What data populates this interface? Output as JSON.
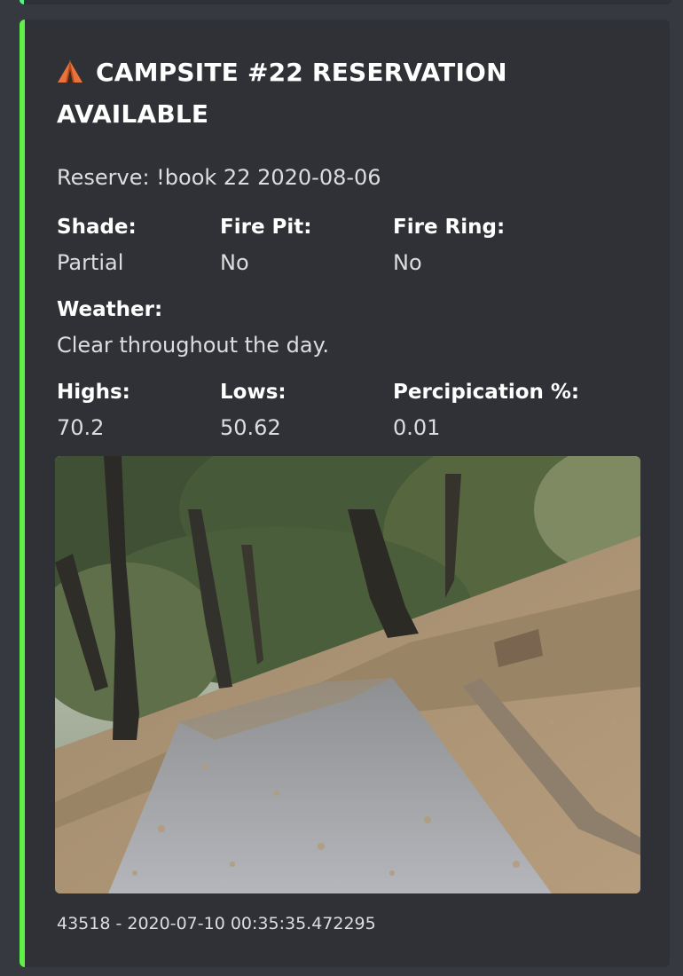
{
  "colors": {
    "accent_bar": "#5ff047",
    "embed_background": "#2f3136",
    "page_background": "#36393f"
  },
  "embed": {
    "title_icon": "tent-icon",
    "title": "CAMPSITE #22 RESERVATION AVAILABLE",
    "description": "Reserve: !book 22 2020-08-06",
    "fields": {
      "shade": {
        "name": "Shade:",
        "value": "Partial"
      },
      "fire_pit": {
        "name": "Fire Pit:",
        "value": "No"
      },
      "fire_ring": {
        "name": "Fire Ring:",
        "value": "No"
      },
      "weather": {
        "name": "Weather:",
        "value": "Clear throughout the day."
      },
      "highs": {
        "name": "Highs:",
        "value": "70.2"
      },
      "lows": {
        "name": "Lows:",
        "value": "50.62"
      },
      "precipitation": {
        "name": "Percipication %:",
        "value": "0.01"
      }
    },
    "image": "campsite-road-photo",
    "footer": "43518 - 2020-07-10 00:35:35.472295"
  }
}
